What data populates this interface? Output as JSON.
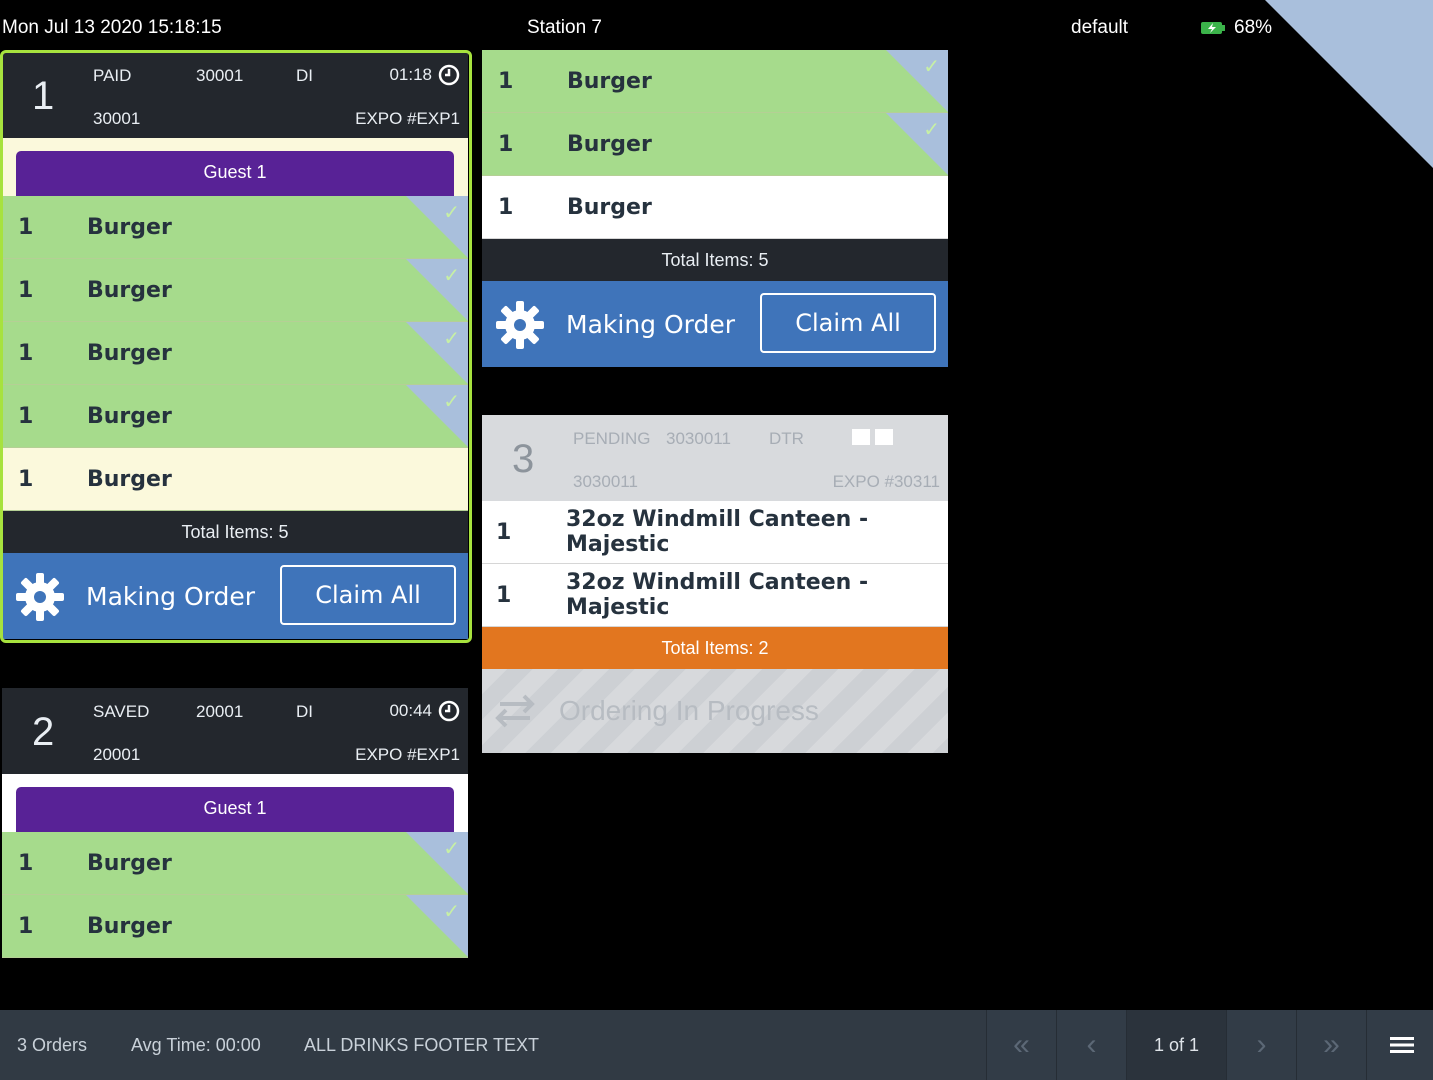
{
  "status_bar": {
    "datetime": "Mon Jul 13 2020 15:18:15",
    "station": "Station 7",
    "profile": "default",
    "battery": "68%"
  },
  "tickets": [
    {
      "number": "1",
      "state": "PAID",
      "order_id": "30001",
      "order_type": "DI",
      "timer": "01:18",
      "order_id_2": "30001",
      "expo": "EXPO #EXP1",
      "guest": "Guest 1",
      "items": [
        {
          "qty": "1",
          "name": "Burger"
        },
        {
          "qty": "1",
          "name": "Burger"
        },
        {
          "qty": "1",
          "name": "Burger"
        },
        {
          "qty": "1",
          "name": "Burger"
        },
        {
          "qty": "1",
          "name": "Burger"
        }
      ],
      "total": "Total Items: 5",
      "action": "Making Order",
      "claim": "Claim All"
    },
    {
      "number": "2",
      "state": "SAVED",
      "order_id": "20001",
      "order_type": "DI",
      "timer": "00:44",
      "order_id_2": "20001",
      "expo": "EXPO #EXP1",
      "guest": "Guest 1",
      "items": [
        {
          "qty": "1",
          "name": "Burger"
        },
        {
          "qty": "1",
          "name": "Burger"
        }
      ]
    },
    {
      "continued_items": [
        {
          "qty": "1",
          "name": "Burger"
        },
        {
          "qty": "1",
          "name": "Burger"
        },
        {
          "qty": "1",
          "name": "Burger"
        }
      ],
      "total": "Total Items: 5",
      "action": "Making Order",
      "claim": "Claim All"
    },
    {
      "number": "3",
      "state": "PENDING",
      "order_id": "3030011",
      "order_type": "DTR",
      "order_id_2": "3030011",
      "expo": "EXPO #30311",
      "items": [
        {
          "qty": "1",
          "name": "32oz Windmill Canteen - Majestic"
        },
        {
          "qty": "1",
          "name": "32oz Windmill Canteen - Majestic"
        }
      ],
      "total": "Total Items: 2",
      "progress": "Ordering In Progress"
    }
  ],
  "footer": {
    "orders": "3 Orders",
    "avg_time": "Avg Time: 00:00",
    "footer_text": "ALL DRINKS FOOTER TEXT",
    "page_info": "1 of 1"
  },
  "colors": {
    "done_item": "#a6db8c",
    "action_bar": "#3f74ba",
    "guest_bar": "#582296",
    "selected_border": "#a7e23e",
    "pending_total": "#e2761f"
  }
}
